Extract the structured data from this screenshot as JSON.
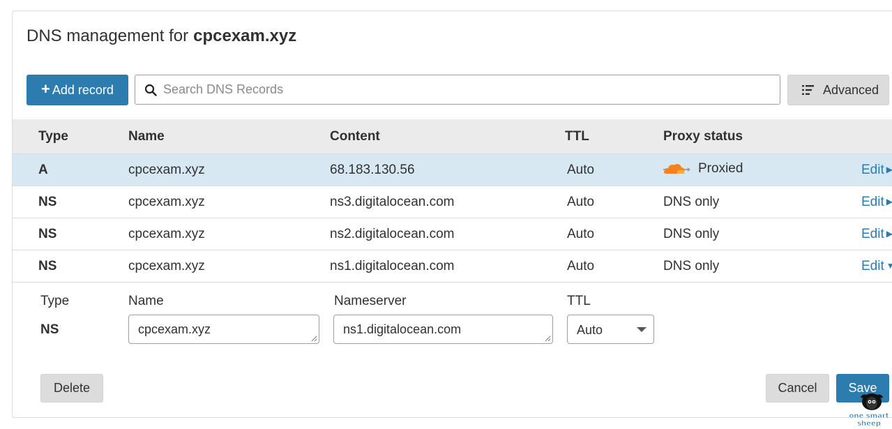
{
  "header": {
    "title_prefix": "DNS management for",
    "domain": "cpcexam.xyz"
  },
  "toolbar": {
    "add_record_label": "Add record",
    "search_placeholder": "Search DNS Records",
    "advanced_label": "Advanced"
  },
  "table": {
    "columns": {
      "type": "Type",
      "name": "Name",
      "content": "Content",
      "ttl": "TTL",
      "proxy_status": "Proxy status"
    },
    "rows": [
      {
        "type": "A",
        "name": "cpcexam.xyz",
        "content": "68.183.130.56",
        "ttl": "Auto",
        "proxy_status": "Proxied",
        "proxied": true,
        "edit": "Edit",
        "selected": true
      },
      {
        "type": "NS",
        "name": "cpcexam.xyz",
        "content": "ns3.digitalocean.com",
        "ttl": "Auto",
        "proxy_status": "DNS only",
        "proxied": false,
        "edit": "Edit",
        "selected": false
      },
      {
        "type": "NS",
        "name": "cpcexam.xyz",
        "content": "ns2.digitalocean.com",
        "ttl": "Auto",
        "proxy_status": "DNS only",
        "proxied": false,
        "edit": "Edit",
        "selected": false
      },
      {
        "type": "NS",
        "name": "cpcexam.xyz",
        "content": "ns1.digitalocean.com",
        "ttl": "Auto",
        "proxy_status": "DNS only",
        "proxied": false,
        "edit": "Edit",
        "selected": false,
        "expanded": true
      }
    ]
  },
  "edit_form": {
    "type_label": "Type",
    "type_value": "NS",
    "name_label": "Name",
    "name_value": "cpcexam.xyz",
    "nameserver_label": "Nameserver",
    "nameserver_value": "ns1.digitalocean.com",
    "ttl_label": "TTL",
    "ttl_value": "Auto",
    "delete_label": "Delete",
    "cancel_label": "Cancel",
    "save_label": "Save"
  },
  "watermark": {
    "text": "one smart sheep"
  },
  "colors": {
    "primary": "#2c7cb0",
    "selected_row": "#d8e8f3",
    "header_bg": "#ebebeb",
    "cloud_orange": "#f6821f"
  },
  "icons": {
    "add": "plus-icon",
    "search": "search-icon",
    "advanced": "filter-list-icon",
    "proxied": "orange-cloud-icon",
    "edit_collapsed": "caret-right-icon",
    "edit_expanded": "caret-down-icon"
  }
}
